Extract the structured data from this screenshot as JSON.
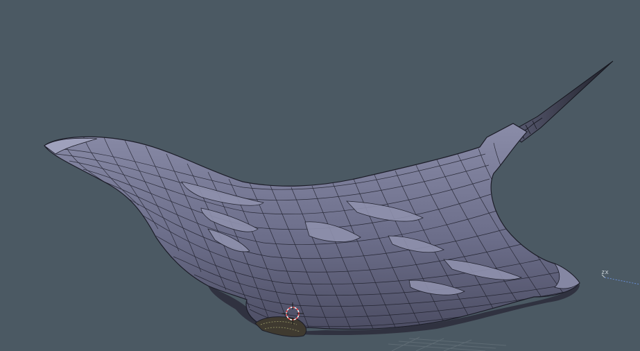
{
  "viewport": {
    "background": "#4b5963",
    "mesh_color": "#6e7088",
    "wire_color": "#1c1d28",
    "object": "manta-ray-mesh"
  },
  "axis_gizmo": {
    "labels": "zx"
  }
}
